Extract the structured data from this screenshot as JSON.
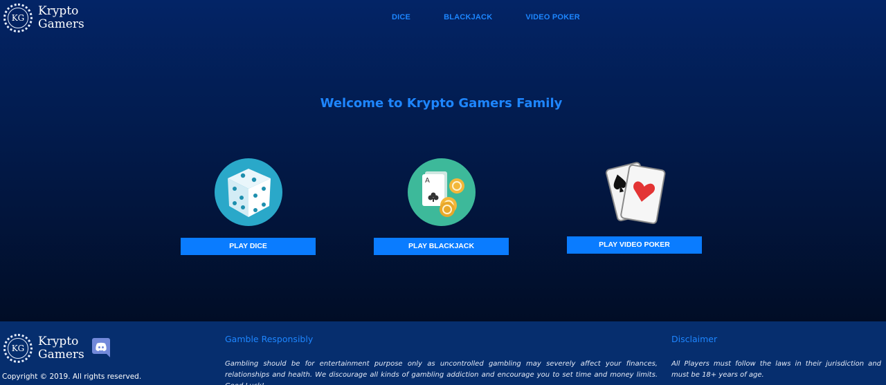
{
  "header": {
    "logo": {
      "initials": "KG",
      "name_line1": "Krypto",
      "name_line2": "Gamers"
    },
    "nav": [
      {
        "label": "DICE"
      },
      {
        "label": "BLACKJACK"
      },
      {
        "label": "VIDEO POKER"
      }
    ]
  },
  "main": {
    "welcome": "Welcome to Krypto Gamers Family",
    "games": [
      {
        "icon": "dice-icon",
        "button": "PLAY DICE"
      },
      {
        "icon": "blackjack-icon",
        "button": "PLAY BLACKJACK"
      },
      {
        "icon": "playing-cards-icon",
        "button": "PLAY VIDEO POKER"
      }
    ]
  },
  "footer": {
    "logo": {
      "initials": "KG",
      "name_line1": "Krypto",
      "name_line2": "Gamers"
    },
    "copyright": "Copyright © 2019. All rights reserved.",
    "discord_icon": "discord-icon",
    "gamble": {
      "title": "Gamble Responsibly",
      "text": "Gambling should be for entertainment purpose only as uncontrolled gambling may severely affect your finances, relationships and health. We discourage all kinds of gambling addiction and encourage you to set time and money limits. Good Luck!"
    },
    "disclaimer": {
      "title": "Disclaimer",
      "text": "All Players must follow the laws in their jurisdiction and must be 18+ years of age."
    }
  },
  "colors": {
    "accent": "#1e86ff",
    "button": "#0a7cff",
    "hero_top": "#032466",
    "hero_bottom": "#010d26",
    "footer_bg": "#062e6e"
  }
}
